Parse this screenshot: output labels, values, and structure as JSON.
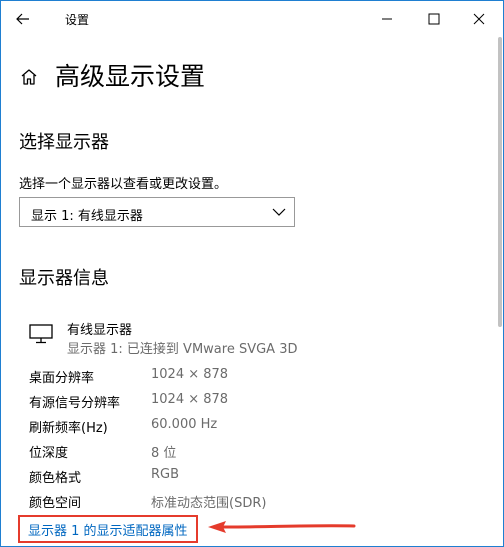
{
  "window": {
    "title": "设置"
  },
  "page": {
    "title": "高级显示设置"
  },
  "select_display": {
    "heading": "选择显示器",
    "description": "选择一个显示器以查看或更改设置。",
    "dropdown_value": "显示 1: 有线显示器"
  },
  "display_info": {
    "heading": "显示器信息",
    "display_name": "有线显示器",
    "display_sub": "显示器 1: 已连接到 VMware SVGA 3D",
    "rows": [
      {
        "label": "桌面分辨率",
        "value": "1024 × 878"
      },
      {
        "label": "有源信号分辨率",
        "value": "1024 × 878"
      },
      {
        "label": "刷新频率(Hz)",
        "value": "60.000 Hz"
      },
      {
        "label": "位深度",
        "value": "8 位"
      },
      {
        "label": "颜色格式",
        "value": "RGB"
      },
      {
        "label": "颜色空间",
        "value": "标准动态范围(SDR)"
      }
    ],
    "adapter_link": "显示器 1 的显示适配器属性"
  },
  "colors": {
    "link": "#0067c0",
    "annotation_red": "#e53b2c",
    "window_border": "#1f7fd1"
  },
  "icons": [
    "back-arrow-icon",
    "minimize-icon",
    "maximize-icon",
    "close-icon",
    "home-icon",
    "chevron-down-icon",
    "monitor-icon",
    "annotation-arrow"
  ]
}
